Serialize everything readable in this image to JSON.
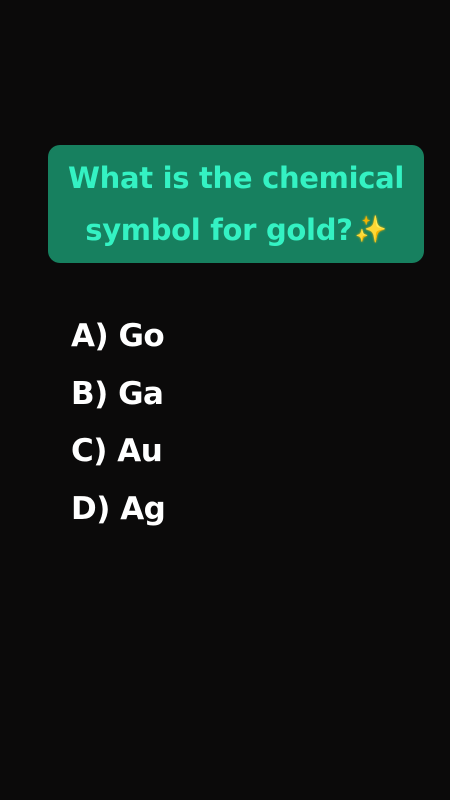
{
  "question": {
    "text": "What is the chemical symbol for gold?",
    "emoji": "✨",
    "emoji_icon": "sparkles-icon",
    "card_color": "#17805f",
    "text_color": "#34f2c3"
  },
  "options": [
    {
      "label": "A) Go"
    },
    {
      "label": "B) Ga"
    },
    {
      "label": "C) Au"
    },
    {
      "label": "D) Ag"
    }
  ],
  "colors": {
    "background": "#0b0a0a",
    "option_text": "#ffffff"
  }
}
